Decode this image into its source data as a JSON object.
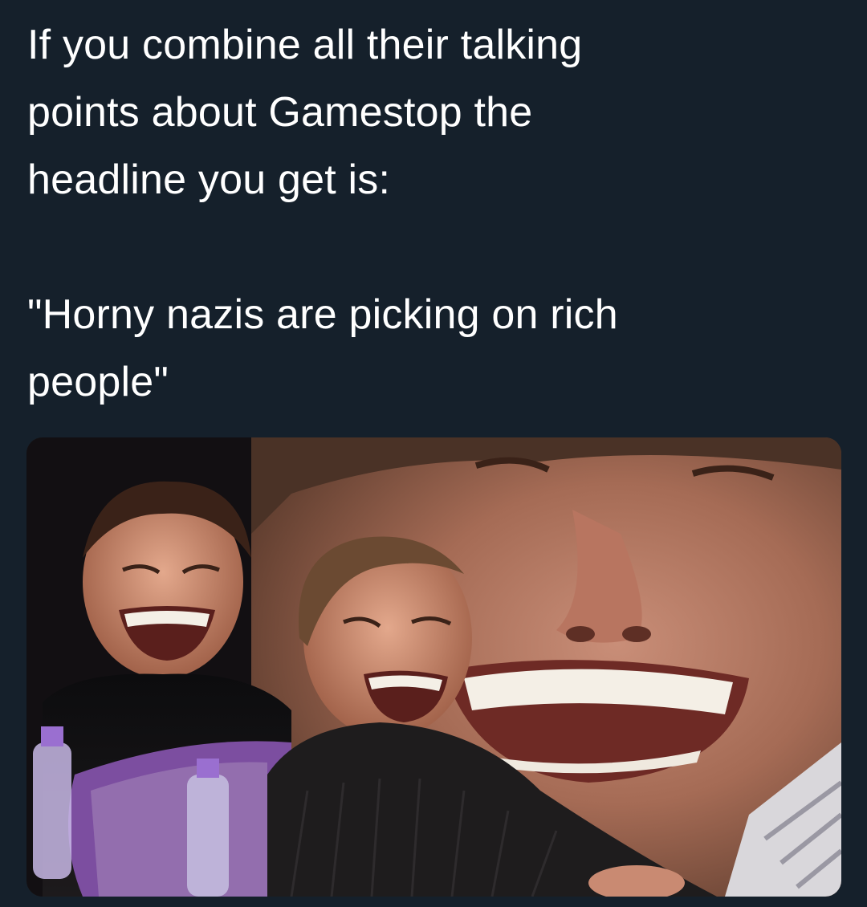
{
  "tweet": {
    "line1": "If you combine all their talking",
    "line2": "points about Gamestop the",
    "line3": "headline you get is:",
    "quote_line1": "\"Horny nazis are picking on rich",
    "quote_line2": "people\""
  },
  "media": {
    "description": "laughing-man-meme-image"
  },
  "colors": {
    "background": "#15202b",
    "text": "#ffffff"
  }
}
